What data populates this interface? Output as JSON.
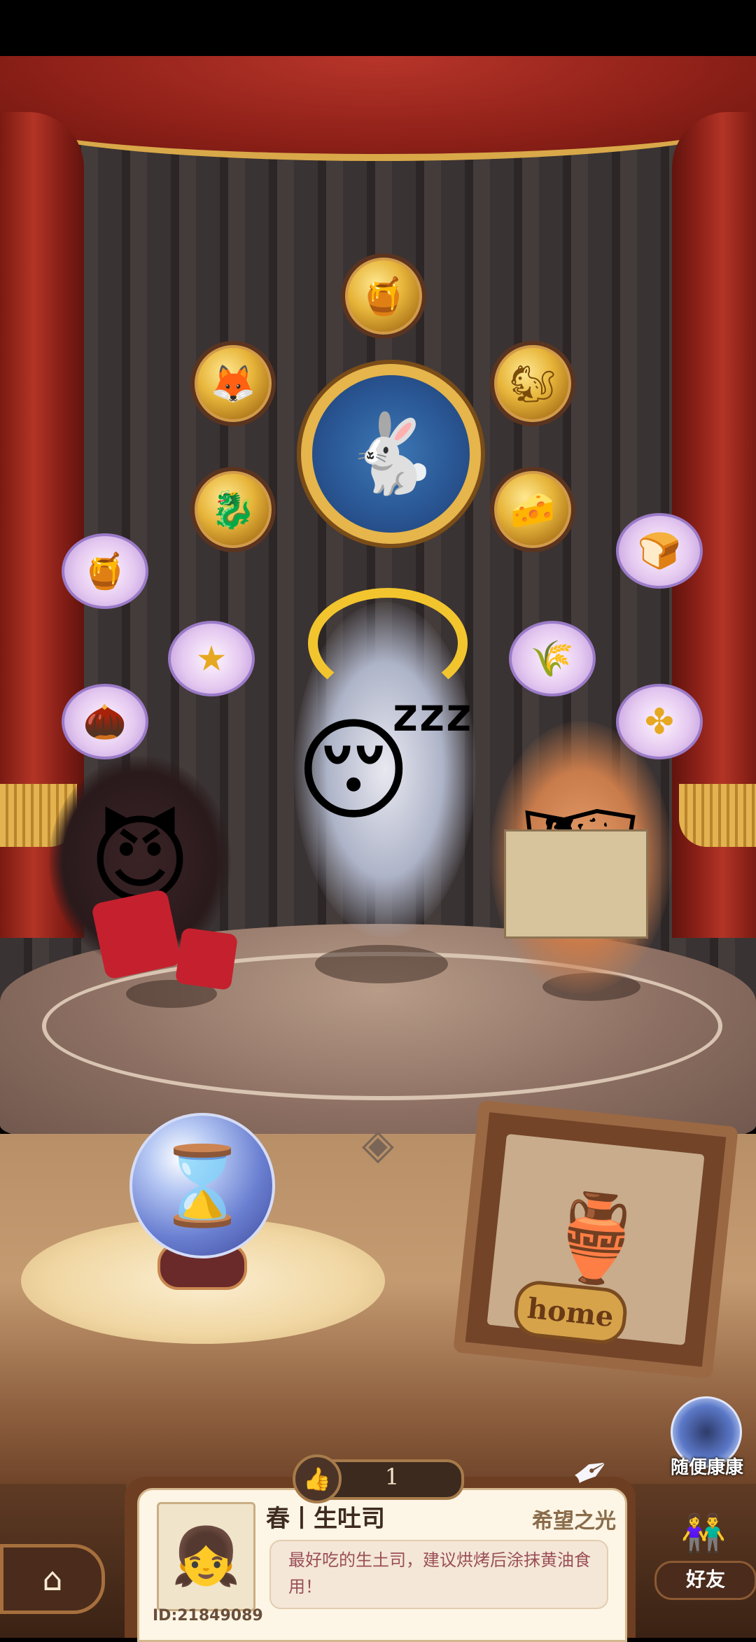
{
  "stage": {
    "medals": [
      {
        "name": "jar-medal-icon",
        "glyph": "🍯"
      },
      {
        "name": "fox-medal-icon",
        "glyph": "🦊"
      },
      {
        "name": "squirrel-medal-icon",
        "glyph": "🐿"
      },
      {
        "name": "dragon-medal-icon",
        "glyph": "🐉"
      },
      {
        "name": "cheese-medal-icon",
        "glyph": "🧀"
      },
      {
        "name": "honeycomb-medal-icon",
        "glyph": "🍯"
      },
      {
        "name": "star-medal-icon",
        "glyph": "★"
      },
      {
        "name": "wheat-medal-icon",
        "glyph": "🌾"
      },
      {
        "name": "bread-medal-icon",
        "glyph": "🍞"
      },
      {
        "name": "walnut-medal-icon",
        "glyph": "🌰"
      },
      {
        "name": "pinwheel-medal-icon",
        "glyph": "✤"
      },
      {
        "name": "rabbit-emblem-icon",
        "glyph": "🐇"
      }
    ],
    "characters": {
      "left": "😈",
      "center": "😴",
      "right": "🗺"
    },
    "hourglass_glyph": "⌛",
    "home_frame_glyph": "🏺",
    "floor_knot_glyph": "◈"
  },
  "home_plaque": "home",
  "random_connect": {
    "label": "随便康康"
  },
  "like": {
    "icon": "👍",
    "count": "1"
  },
  "profile": {
    "avatar_glyph": "👧",
    "name": "春丨生吐司",
    "title": "希望之光",
    "bio": "最好吃的生土司，建议烘烤后涂抹黄油食用！",
    "id": "ID:21849089"
  },
  "nav": {
    "home_glyph": "⌂",
    "friends_glyph": "👫",
    "friends_label": "好友",
    "quill_glyph": "✒"
  }
}
